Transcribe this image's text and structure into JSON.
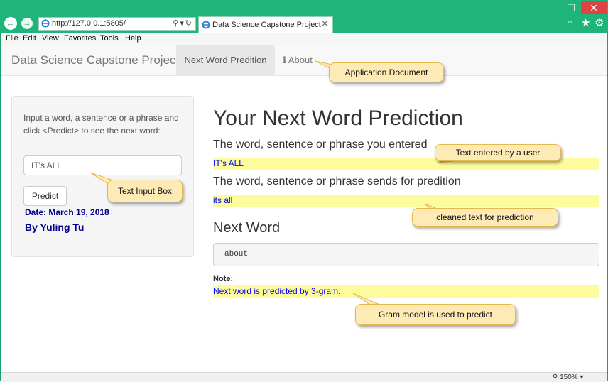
{
  "browser": {
    "url": "http://127.0.0.1:5805/",
    "tab_title": "Data Science Capstone Project",
    "menu": [
      "File",
      "Edit",
      "View",
      "Favorites",
      "Tools",
      "Help"
    ],
    "zoom": "150%",
    "accent_color": "#1fb57a"
  },
  "navbar": {
    "brand": "Data Science Capstone Project",
    "tab_active": "Next Word Predition",
    "tab_about": "About",
    "about_icon": "info-icon"
  },
  "sidebar": {
    "instruction": "Input a word, a sentence or a phrase and click <Predict> to see the next word:",
    "input_value": "IT's ALL",
    "predict_label": "Predict",
    "date": "Date: March 19, 2018",
    "author": "By Yuling Tu"
  },
  "main": {
    "title": "Your Next Word Prediction",
    "entered_heading": "The word, sentence or phrase you entered",
    "entered_text": "IT's ALL",
    "sends_heading": "The word, sentence or phrase sends for predition",
    "cleaned_text": "its all",
    "next_word_heading": "Next Word",
    "next_word": "about",
    "note_label": "Note:",
    "note_text": "Next word is predicted by 3-gram.",
    "highlight_color": "#fdfc9c"
  },
  "callouts": {
    "app_doc": "Application Document",
    "text_entered": "Text entered by a user",
    "text_input_box": "Text Input Box",
    "cleaned": "cleaned text for prediction",
    "gram_model": "Gram model is used to predict"
  }
}
